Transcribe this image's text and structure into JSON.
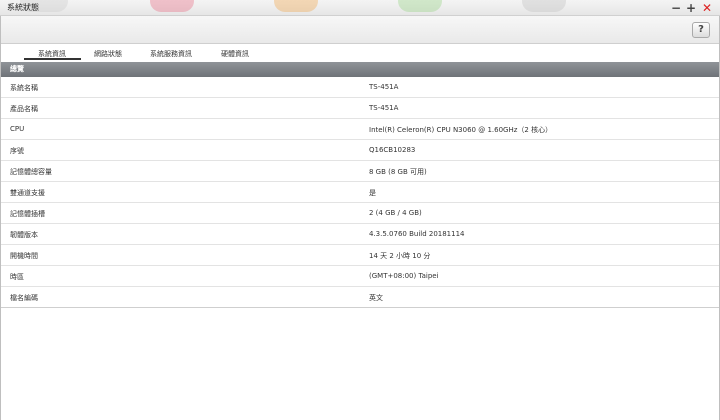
{
  "window": {
    "title": "系統狀態"
  },
  "toolbar": {
    "help_label": "?"
  },
  "tabs": [
    {
      "label": "系統資訊"
    },
    {
      "label": "網路狀態"
    },
    {
      "label": "系統服務資訊"
    },
    {
      "label": "硬體資訊"
    }
  ],
  "section": {
    "title": "總覽"
  },
  "rows": [
    {
      "label": "系統名稱",
      "value": "TS-451A"
    },
    {
      "label": "產品名稱",
      "value": "TS-451A"
    },
    {
      "label": "CPU",
      "value": "Intel(R) Celeron(R) CPU N3060 @ 1.60GHz（2 核心）"
    },
    {
      "label": "序號",
      "value": "Q16CB10283"
    },
    {
      "label": "記憶體總容量",
      "value": "8 GB (8 GB 可用)"
    },
    {
      "label": "雙通道支援",
      "value": "是"
    },
    {
      "label": "記憶體插槽",
      "value": "2 (4 GB / 4 GB)"
    },
    {
      "label": "韌體版本",
      "value": "4.3.5.0760 Build 20181114"
    },
    {
      "label": "開機時間",
      "value": "14 天 2 小時 10 分"
    },
    {
      "label": "時區",
      "value": "(GMT+08:00) Taipei"
    },
    {
      "label": "檔名編碼",
      "value": "英文"
    }
  ],
  "colors": {
    "accent_close": "#d22222",
    "section_header": "#7a7e83"
  }
}
